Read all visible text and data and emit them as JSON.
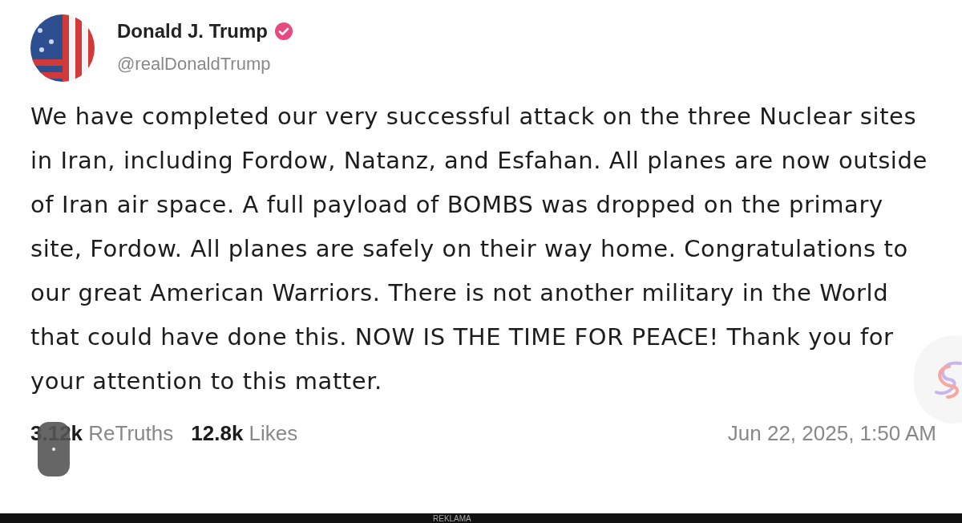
{
  "post": {
    "author": {
      "name": "Donald J. Trump",
      "verified": true,
      "handle": "@realDonaldTrump"
    },
    "text": "We have completed our very successful attack on the three Nuclear sites in Iran, including Fordow, Natanz, and Esfahan. All planes are now outside of Iran air space. A full payload of BOMBS was dropped on the primary site, Fordow. All planes are safely on their way home. Congratulations to our great American Warriors. There is not another military in the World that could have done this. NOW IS THE TIME FOR PEACE! Thank you for your attention to this matter.",
    "stats": [
      {
        "count": "3.12k",
        "label": "ReTruths"
      },
      {
        "count": "12.8k",
        "label": "Likes"
      }
    ],
    "timestamp": "Jun 22, 2025, 1:50 AM"
  },
  "ad_bar": {
    "label": "REKLAMA"
  }
}
